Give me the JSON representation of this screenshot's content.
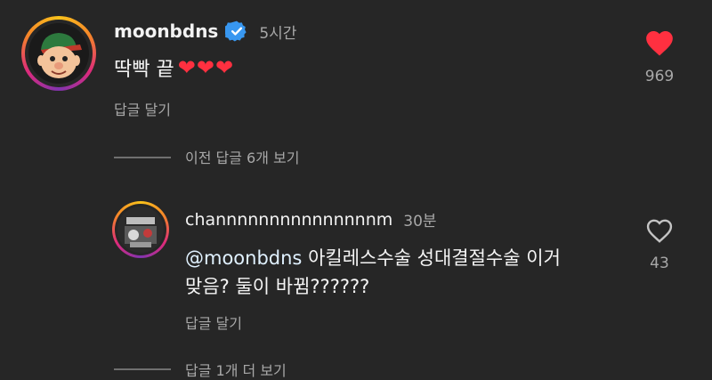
{
  "comment": {
    "username": "moonbdns",
    "time": "5시간",
    "text": "딱빡 끝",
    "hearts": "❤❤❤",
    "reply_label": "답글 달기",
    "like_count": "969",
    "liked": true
  },
  "view_previous": "이전 답글 6개 보기",
  "reply": {
    "username": "channnnnnnnnnnnnnnm",
    "time": "30분",
    "mention": "@moonbdns",
    "text_line1": "아킬레스수술 성대결절수술 이거",
    "text_line2": "맞음? 둘이 바뀜??????",
    "reply_label": "답글 달기",
    "like_count": "43",
    "liked": false
  },
  "view_more": "답글 1개 더 보기",
  "colors": {
    "background": "#262626",
    "like_red": "#ff3040",
    "verified_blue": "#3897f0",
    "muted_text": "#a8a8a8"
  }
}
